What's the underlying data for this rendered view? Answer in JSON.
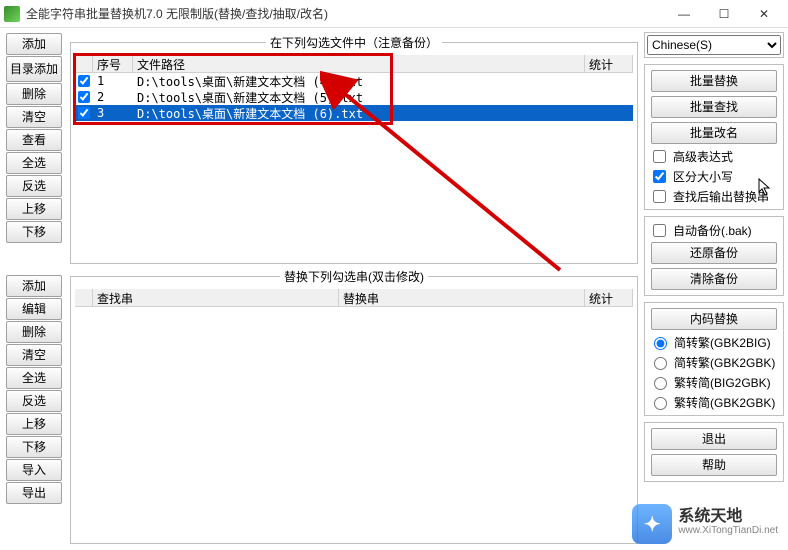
{
  "window": {
    "title": "全能字符串批量替换机7.0 无限制版(替换/查找/抽取/改名)",
    "min": "—",
    "max": "☐",
    "close": "✕"
  },
  "top_panel": {
    "legend": "在下列勾选文件中（注意备份）",
    "headers": {
      "seq": "序号",
      "path": "文件路径",
      "stat": "统计"
    },
    "rows": [
      {
        "idx": "1",
        "path": "D:\\tools\\桌面\\新建文本文档 (4).txt",
        "selected": false
      },
      {
        "idx": "2",
        "path": "D:\\tools\\桌面\\新建文本文档 (5).txt",
        "selected": false
      },
      {
        "idx": "3",
        "path": "D:\\tools\\桌面\\新建文本文档 (6).txt",
        "selected": true
      }
    ]
  },
  "bottom_panel": {
    "legend": "替换下列勾选串(双击修改)",
    "headers": {
      "search": "查找串",
      "replace": "替换串",
      "stat": "统计"
    }
  },
  "left_buttons_top": [
    "添加",
    "目录添加",
    "删除",
    "清空",
    "查看",
    "全选",
    "反选",
    "上移",
    "下移"
  ],
  "left_buttons_bottom": [
    "添加",
    "编辑",
    "删除",
    "清空",
    "全选",
    "反选",
    "上移",
    "下移",
    "导入",
    "导出"
  ],
  "right": {
    "language": "Chinese(S)",
    "actions": {
      "replace": "批量替换",
      "find": "批量查找",
      "rename": "批量改名"
    },
    "options": {
      "advanced": "高级表达式",
      "case": "区分大小写",
      "output": "查找后输出替换串"
    },
    "backup": {
      "auto": "自动备份(.bak)",
      "restore": "还原备份",
      "clear": "清除备份"
    },
    "encoding": {
      "title": "内码替换",
      "opts": [
        "简转繁(GBK2BIG)",
        "简转繁(GBK2GBK)",
        "繁转简(BIG2GBK)",
        "繁转简(GBK2GBK)"
      ]
    },
    "exit": "退出",
    "help": "帮助"
  },
  "watermark": {
    "cn": "系统天地",
    "url": "www.XiTongTianDi.net"
  }
}
